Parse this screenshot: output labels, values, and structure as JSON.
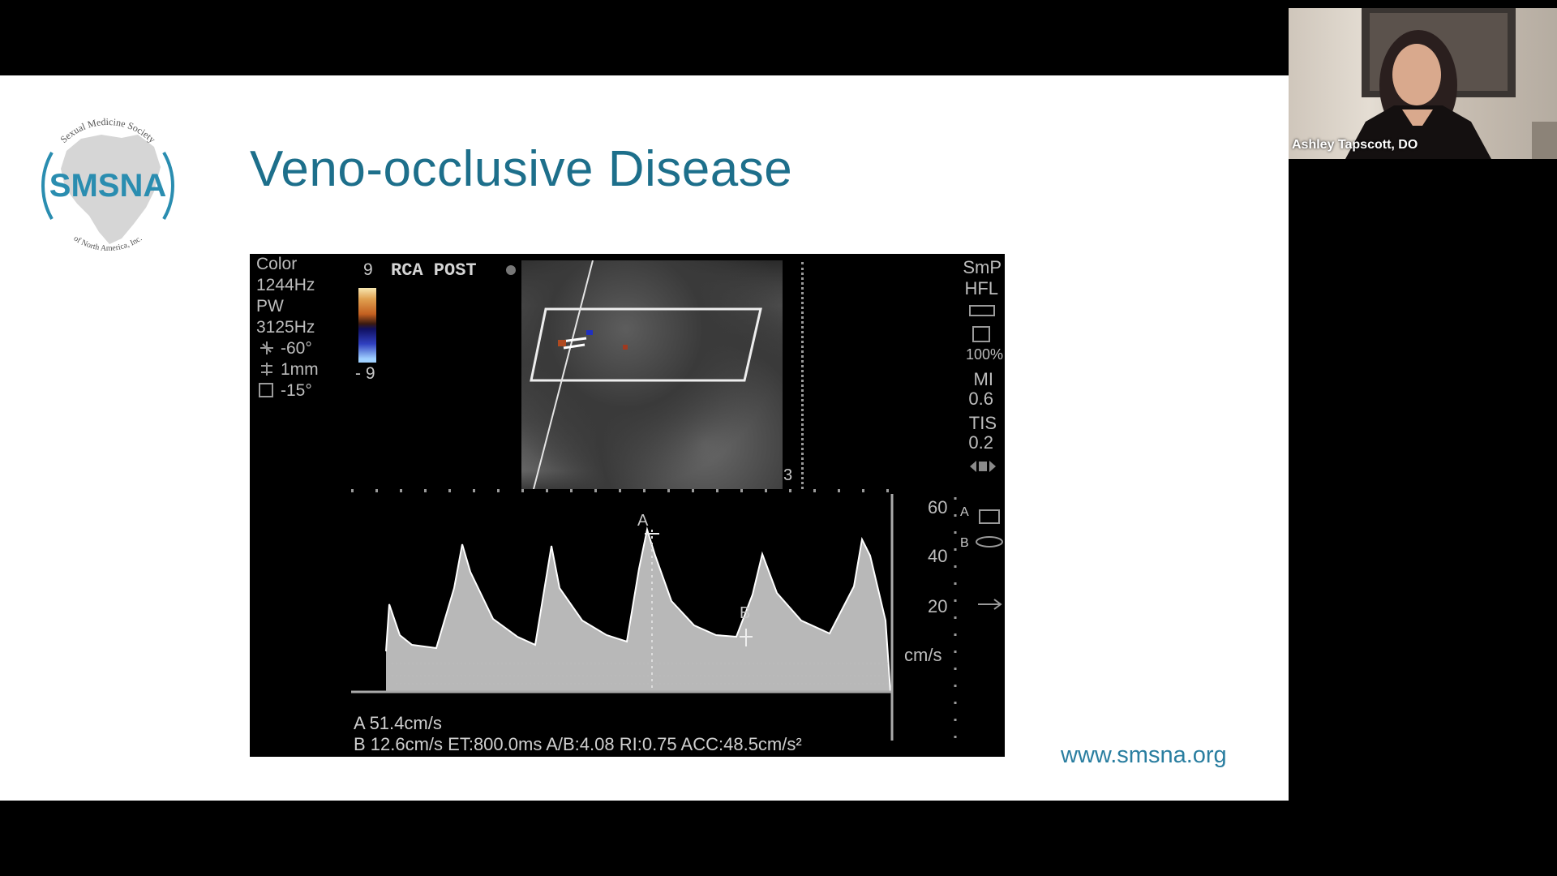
{
  "slide": {
    "title": "Veno-occlusive Disease",
    "url": "www.smsna.org",
    "logo": {
      "main": "SMSNA",
      "arc_top": "Sexual Medicine Society",
      "arc_bottom": "of North America, Inc."
    }
  },
  "ultrasound": {
    "params": [
      "Color",
      "1244Hz",
      "PW",
      "3125Hz",
      "-60°",
      "1mm",
      "-15°"
    ],
    "color_scale_top": "9",
    "color_scale_bottom": "- 9",
    "label": "RCA POST",
    "right_labels": [
      "SmP",
      "HFL",
      "100%",
      "MI",
      "0.6",
      "TIS",
      "0.2"
    ],
    "depth_marker": "3",
    "scale_values": [
      "60",
      "40",
      "20"
    ],
    "scale_unit": "cm/s",
    "cursor_a": "A",
    "cursor_b": "B",
    "side_a": "A",
    "side_b": "B",
    "measurement_a": "A  51.4cm/s",
    "measurement_b": "B  12.6cm/s   ET:800.0ms  A/B:4.08  RI:0.75  ACC:48.5cm/s²"
  },
  "webcam": {
    "participant_name": "Ashley Tapscott, DO"
  },
  "colors": {
    "title": "#1d6f8b",
    "url": "#2a7ea0",
    "logo": "#2a8db0"
  }
}
